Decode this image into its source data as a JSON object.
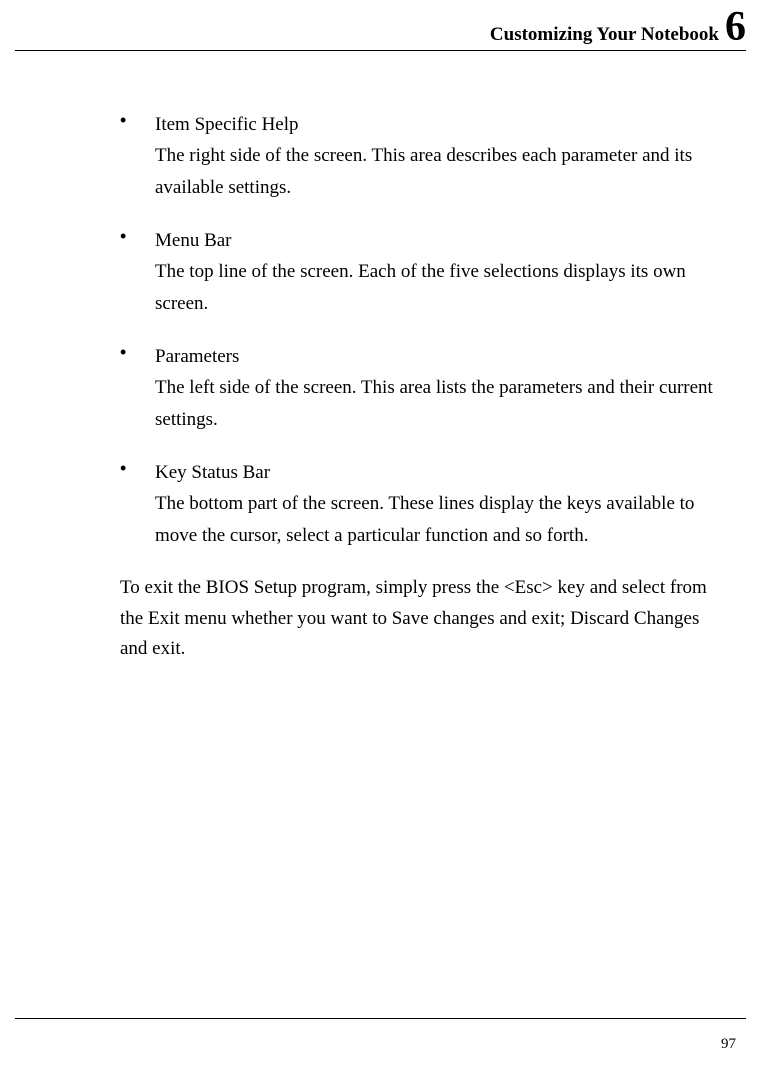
{
  "header": {
    "title": "Customizing Your Notebook",
    "chapter": "6"
  },
  "items": [
    {
      "title": "Item Specific Help",
      "desc": "The right side of the screen. This area describes each parameter and its available settings."
    },
    {
      "title": "Menu Bar",
      "desc": "The top line of the screen. Each of the five selections displays its own screen."
    },
    {
      "title": "Parameters",
      "desc": "The left side of the screen. This area lists the parameters and their current settings."
    },
    {
      "title": "Key Status Bar",
      "desc": "The bottom part of the screen. These lines display the keys available to move the cursor, select a particular function and so forth."
    }
  ],
  "closing": "To exit the BIOS Setup program, simply press the <Esc> key and select from the Exit menu whether you want to Save changes and exit; Discard Changes and exit.",
  "page_number": "97"
}
